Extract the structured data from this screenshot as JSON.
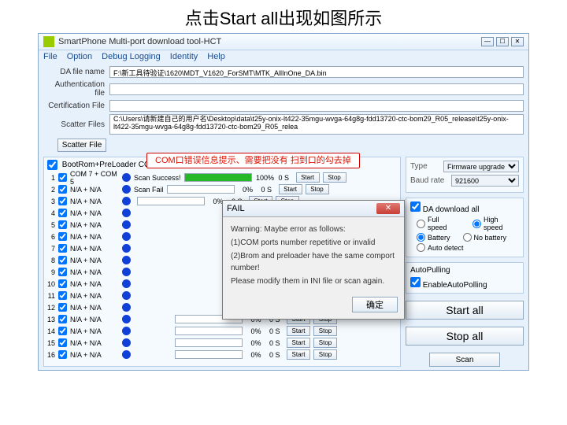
{
  "caption": "点击Start all出现如图所示",
  "window": {
    "title": "SmartPhone Multi-port download tool-HCT",
    "menu": [
      "File",
      "Option",
      "Debug Logging",
      "Identity",
      "Help"
    ]
  },
  "files": {
    "da_label": "DA file name",
    "da_value": "F:\\新工具待验证\\1620\\MDT_V1620_ForSMT\\MTK_AllInOne_DA.bin",
    "auth_label": "Authentication file",
    "auth_value": "",
    "cert_label": "Certification File",
    "cert_value": "",
    "scatter_label": "Scatter Files",
    "scatter_btn": "Scatter File",
    "scatter_value": "C:\\Users\\请新建自己的用户名\\Desktop\\data\\t25y-onix-lt422-35mgu-wvga-64g8g-fdd13720-ctc-bom29_R05_release\\t25y-onix-lt422-35mgu-wvga-64g8g-fdd13720-ctc-bom29_R05_relea"
  },
  "callout": "COM口错误信息提示、需要把没有\n扫到口的勾去掉",
  "left": {
    "sel_all": "BootRom+PreLoader COM Sel All",
    "scan_success": "Scan Success!",
    "scan_fail": "Scan Fail",
    "pct100": "100%",
    "pct0": "0%",
    "os": "0 S",
    "start": "Start",
    "stop": "Stop",
    "ports": [
      {
        "n": "1",
        "com": "COM 7 + COM 5",
        "success": true
      },
      {
        "n": "2",
        "com": "N/A + N/A",
        "fail": true
      },
      {
        "n": "3",
        "com": "N/A + N/A",
        "fail": true
      },
      {
        "n": "4",
        "com": "N/A + N/A"
      },
      {
        "n": "5",
        "com": "N/A + N/A"
      },
      {
        "n": "6",
        "com": "N/A + N/A"
      },
      {
        "n": "7",
        "com": "N/A + N/A"
      },
      {
        "n": "8",
        "com": "N/A + N/A"
      },
      {
        "n": "9",
        "com": "N/A + N/A"
      },
      {
        "n": "10",
        "com": "N/A + N/A"
      },
      {
        "n": "11",
        "com": "N/A + N/A"
      },
      {
        "n": "12",
        "com": "N/A + N/A"
      },
      {
        "n": "13",
        "com": "N/A + N/A",
        "tail": true
      },
      {
        "n": "14",
        "com": "N/A + N/A",
        "tail": true
      },
      {
        "n": "15",
        "com": "N/A + N/A",
        "tail": true
      },
      {
        "n": "16",
        "com": "N/A + N/A",
        "tail": true
      }
    ]
  },
  "right": {
    "type_label": "Type",
    "type_value": "Firmware upgrade",
    "baud_label": "Baud rate",
    "baud_value": "921600",
    "da_download": "DA download all",
    "full_speed": "Full speed",
    "high_speed": "High speed",
    "battery": "Battery",
    "no_battery": "No battery",
    "auto_detect": "Auto detect",
    "autopull": "AutoPulling",
    "enable_autopull": "EnableAutoPolling",
    "start_all": "Start all",
    "stop_all": "Stop all",
    "scan": "Scan"
  },
  "dialog": {
    "title": "FAIL",
    "line1": "Warning: Maybe error as follows:",
    "line2": "(1)COM ports number repetitive or invalid",
    "line3": "(2)Brom and preloader have the same comport number!",
    "line4": "Please modify them in INI file or scan again.",
    "ok": "确定"
  }
}
